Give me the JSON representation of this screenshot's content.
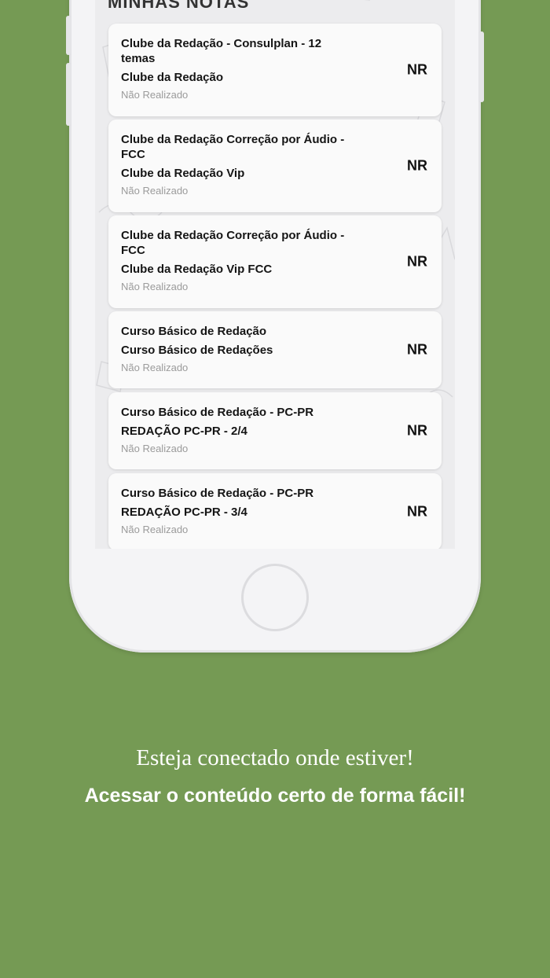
{
  "screen": {
    "section_title": "MINHAS NOTAS",
    "cards": [
      {
        "course": "Clube da Redação - Consulplan - 12 temas",
        "theme": "Clube da Redação",
        "status": "Não Realizado",
        "grade": "NR"
      },
      {
        "course": "Clube da Redação Correção por Áudio - FCC",
        "theme": "Clube da Redação Vip",
        "status": "Não Realizado",
        "grade": "NR"
      },
      {
        "course": "Clube da Redação Correção por Áudio - FCC",
        "theme": "Clube da Redação Vip FCC",
        "status": "Não Realizado",
        "grade": "NR"
      },
      {
        "course": "Curso Básico de Redação",
        "theme": "Curso Básico de Redações",
        "status": "Não Realizado",
        "grade": "NR"
      },
      {
        "course": "Curso Básico de Redação - PC-PR",
        "theme": "REDAÇÃO PC-PR - 2/4",
        "status": "Não Realizado",
        "grade": "NR"
      },
      {
        "course": "Curso Básico de Redação - PC-PR",
        "theme": "REDAÇÃO PC-PR - 3/4",
        "status": "Não Realizado",
        "grade": "NR"
      }
    ]
  },
  "captions": {
    "line1": "Esteja conectado onde estiver!",
    "line2": "Acessar o conteúdo certo de forma fácil!"
  },
  "colors": {
    "background": "#759a54",
    "phone_body": "#f4f4f6",
    "card": "#fafafa"
  }
}
